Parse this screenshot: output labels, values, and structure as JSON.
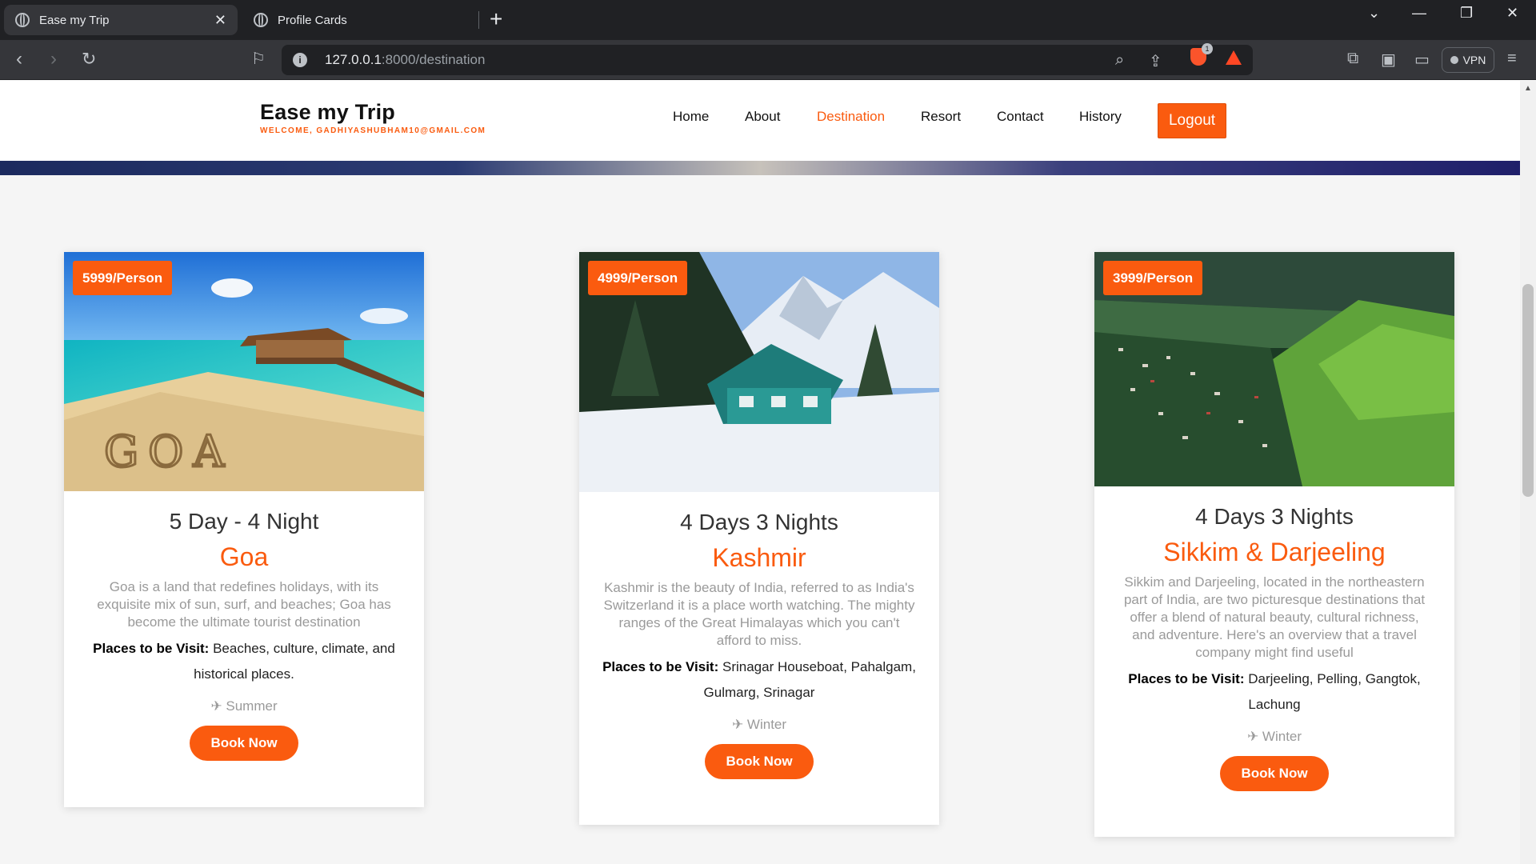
{
  "browser": {
    "tabs": [
      {
        "title": "Ease my Trip",
        "active": true
      },
      {
        "title": "Profile Cards",
        "active": false
      }
    ],
    "url_host": "127.0.0.1",
    "url_path": ":8000/destination",
    "brave_count": "1",
    "vpn_label": "VPN"
  },
  "site": {
    "brand": "Ease my Trip",
    "welcome": "WELCOME, GADHIYASHUBHAM10@GMAIL.COM",
    "nav": [
      "Home",
      "About",
      "Destination",
      "Resort",
      "Contact",
      "History"
    ],
    "nav_active": "Destination",
    "logout": "Logout",
    "accent_color": "#fa5b0f"
  },
  "destinations": [
    {
      "price": "5999/Person",
      "duration": "5 Day - 4 Night",
      "name": "Goa",
      "description": "Goa is a land that redefines holidays, with its exquisite mix of sun, surf, and beaches; Goa has become the ultimate tourist destination",
      "places_label": "Places to be Visit:",
      "places": "Beaches, culture, climate, and historical places.",
      "season": "Summer",
      "book": "Book Now",
      "image": "beach-pier-goa"
    },
    {
      "price": "4999/Person",
      "duration": "4 Days 3 Nights",
      "name": "Kashmir",
      "description": "Kashmir is the beauty of India, referred to as India's Switzerland it is a place worth watching. The mighty ranges of the Great Himalayas which you can't afford to miss.",
      "places_label": "Places to be Visit:",
      "places": "Srinagar Houseboat, Pahalgam, Gulmarg, Srinagar",
      "season": "Winter",
      "book": "Book Now",
      "image": "snowy-mountain-cabin"
    },
    {
      "price": "3999/Person",
      "duration": "4 Days 3 Nights",
      "name": "Sikkim & Darjeeling",
      "description": "Sikkim and Darjeeling, located in the northeastern part of India, are two picturesque destinations that offer a blend of natural beauty, cultural richness, and adventure. Here's an overview that a travel company might find useful",
      "places_label": "Places to be Visit:",
      "places": "Darjeeling, Pelling, Gangtok, Lachung",
      "season": "Winter",
      "book": "Book Now",
      "image": "green-hills-town"
    }
  ]
}
